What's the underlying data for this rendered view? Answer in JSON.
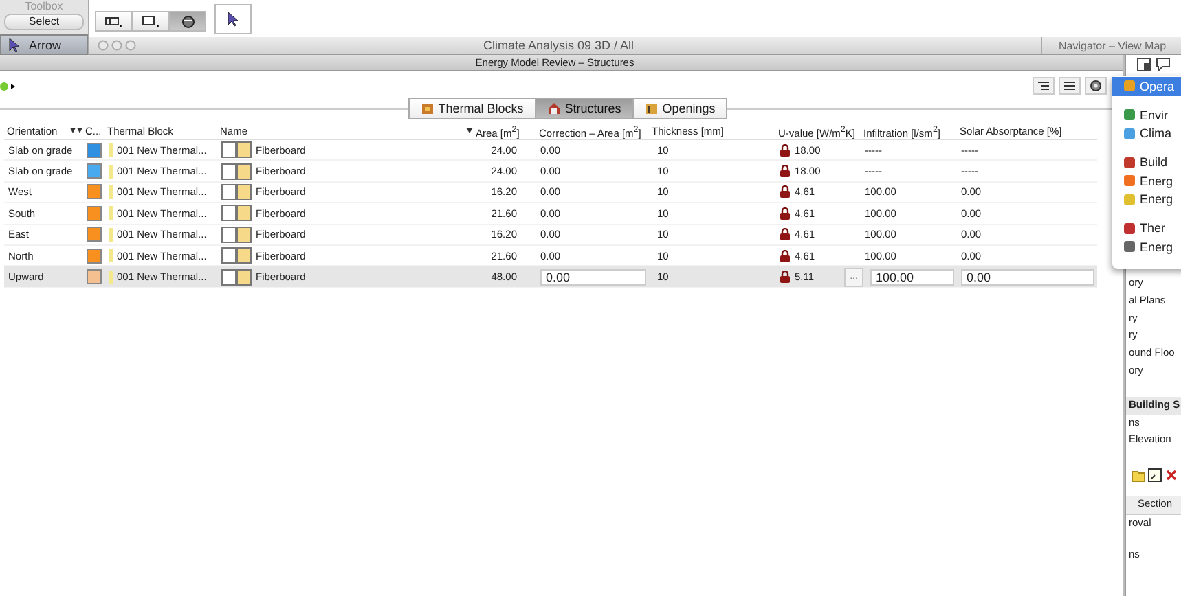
{
  "toolbox": {
    "title": "Toolbox",
    "select_label": "Select",
    "tool": "Arrow"
  },
  "toolbar_buttons": [
    {
      "kind": "wall",
      "selected": false
    },
    {
      "kind": "box",
      "selected": false
    },
    {
      "kind": "render",
      "selected": true
    },
    {
      "kind": "arrow",
      "selected": false
    }
  ],
  "window": {
    "title": "Climate Analysis 09 3D / All"
  },
  "navigator": {
    "title": "Navigator – View Map",
    "items": [
      {
        "label": "ory",
        "header": false
      },
      {
        "label": "al Plans",
        "header": false
      },
      {
        "label": "ry",
        "header": false
      },
      {
        "label": "ry",
        "header": false
      },
      {
        "label": "ound Floo",
        "header": false
      },
      {
        "label": "ory",
        "header": false
      },
      {
        "label": "Building S",
        "header": true
      },
      {
        "label": "ns",
        "header": false
      },
      {
        "label": "Elevation",
        "header": false
      }
    ],
    "lower_items": [
      {
        "label": "Section",
        "header": true
      },
      {
        "label": "roval",
        "header": false
      },
      {
        "label": "ns",
        "header": false
      }
    ]
  },
  "palette": {
    "title": "Energy Model Review – Structures"
  },
  "tabs": [
    {
      "label": "Thermal Blocks",
      "selected": false
    },
    {
      "label": "Structures",
      "selected": true
    },
    {
      "label": "Openings",
      "selected": false
    }
  ],
  "table": {
    "columns": [
      {
        "label": "Orientation",
        "kind": "double"
      },
      {
        "label": "C...",
        "kind": "plain"
      },
      {
        "label": "Thermal Block",
        "kind": "plain"
      },
      {
        "label": "Name",
        "kind": "single"
      },
      {
        "label": "Area [m$^{2}$]",
        "kind": "plain"
      },
      {
        "label": "Correction – Area [m$^{2}$]",
        "kind": "plain"
      },
      {
        "label": "Thickness [mm]",
        "kind": "plain"
      },
      {
        "label": "U-value [W/m$^{2}$K]",
        "kind": "plain"
      },
      {
        "label": "Infiltration [l/sm$^{2}$]",
        "kind": "plain"
      },
      {
        "label": "Solar Absorptance [%]",
        "kind": "plain"
      }
    ],
    "rows": [
      {
        "orientation": "Slab on grade",
        "color": "#2f8fe0",
        "thermal_block": "001 New Thermal...",
        "name": "Fiberboard",
        "area": "24.00",
        "correction": "0.00",
        "thickness": "10",
        "u_value": "18.00",
        "infiltration": "-----",
        "solar_absorptance": "-----",
        "selected": false
      },
      {
        "orientation": "Slab on grade",
        "color": "#4aaaf0",
        "thermal_block": "001 New Thermal...",
        "name": "Fiberboard",
        "area": "24.00",
        "correction": "0.00",
        "thickness": "10",
        "u_value": "18.00",
        "infiltration": "-----",
        "solar_absorptance": "-----",
        "selected": false
      },
      {
        "orientation": "West",
        "color": "#f7901e",
        "thermal_block": "001 New Thermal...",
        "name": "Fiberboard",
        "area": "16.20",
        "correction": "0.00",
        "thickness": "10",
        "u_value": "4.61",
        "infiltration": "100.00",
        "solar_absorptance": "0.00",
        "selected": false
      },
      {
        "orientation": "South",
        "color": "#f7901e",
        "thermal_block": "001 New Thermal...",
        "name": "Fiberboard",
        "area": "21.60",
        "correction": "0.00",
        "thickness": "10",
        "u_value": "4.61",
        "infiltration": "100.00",
        "solar_absorptance": "0.00",
        "selected": false
      },
      {
        "orientation": "East",
        "color": "#f7901e",
        "thermal_block": "001 New Thermal...",
        "name": "Fiberboard",
        "area": "16.20",
        "correction": "0.00",
        "thickness": "10",
        "u_value": "4.61",
        "infiltration": "100.00",
        "solar_absorptance": "0.00",
        "selected": false
      },
      {
        "orientation": "North",
        "color": "#f7901e",
        "thermal_block": "001 New Thermal...",
        "name": "Fiberboard",
        "area": "21.60",
        "correction": "0.00",
        "thickness": "10",
        "u_value": "4.61",
        "infiltration": "100.00",
        "solar_absorptance": "0.00",
        "selected": false
      },
      {
        "orientation": "Upward",
        "color": "#f5c08f",
        "thermal_block": "001 New Thermal...",
        "name": "Fiberboard",
        "area": "48.00",
        "correction": "0.00",
        "thickness": "10",
        "u_value": "5.11",
        "infiltration": "100.00",
        "solar_absorptance": "0.00",
        "selected": true,
        "browse_label": "..."
      }
    ]
  },
  "menu": {
    "items": [
      {
        "label": "Opera",
        "selected": true
      },
      {
        "label": "Envir",
        "selected": false
      },
      {
        "label": "Clima",
        "selected": false
      },
      {
        "label": "Build",
        "selected": false
      },
      {
        "label": "Energ",
        "selected": false
      },
      {
        "label": "Energ",
        "selected": false
      },
      {
        "label": "Ther",
        "selected": false
      },
      {
        "label": "Energ",
        "selected": false
      }
    ]
  }
}
